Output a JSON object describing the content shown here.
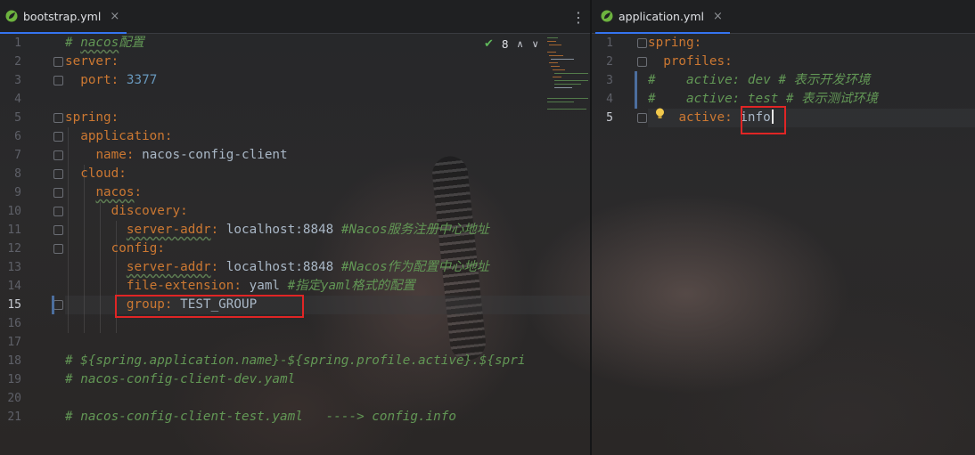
{
  "left_tab": {
    "title": "bootstrap.yml",
    "close": "×"
  },
  "right_tab": {
    "title": "application.yml",
    "close": "×"
  },
  "menu_icon": "⋮",
  "inspections": {
    "count": "8",
    "up": "∧",
    "down": "∨"
  },
  "left_lines": [
    {
      "n": "1"
    },
    {
      "n": "2"
    },
    {
      "n": "3"
    },
    {
      "n": "4"
    },
    {
      "n": "5"
    },
    {
      "n": "6"
    },
    {
      "n": "7"
    },
    {
      "n": "8"
    },
    {
      "n": "9"
    },
    {
      "n": "10"
    },
    {
      "n": "11"
    },
    {
      "n": "12"
    },
    {
      "n": "13"
    },
    {
      "n": "14"
    },
    {
      "n": "15"
    },
    {
      "n": "16"
    },
    {
      "n": "17"
    },
    {
      "n": "18"
    },
    {
      "n": "19"
    },
    {
      "n": "20"
    },
    {
      "n": "21"
    }
  ],
  "left_code": {
    "l1_hash": "# ",
    "l1_comment": "nacos",
    "l1_rest": "配置",
    "l2_key": "server",
    "l3_key": "port",
    "l3_val": "3377",
    "l5_key": "spring",
    "l6_key": "application",
    "l7_key": "name",
    "l7_val": "nacos-config-client",
    "l8_key": "cloud",
    "l9_key": "nacos",
    "l10_key": "discovery",
    "l11_key": "server-addr",
    "l11_val": "localhost:8848",
    "l11_comment": "#Nacos服务注册中心地址",
    "l12_key": "config",
    "l13_key": "server-addr",
    "l13_val": "localhost:8848",
    "l13_comment": "#Nacos作为配置中心地址",
    "l14_key": "file-extension",
    "l14_val": "yaml",
    "l14_comment": "#指定yaml格式的配置",
    "l15_key": "group",
    "l15_val": "TEST_GROUP",
    "l18_comment": "# ${spring.application.name}-${spring.profile.active}.${spri",
    "l19_comment": "# nacos-config-client-dev.yaml",
    "l21_comment": "# nacos-config-client-test.yaml   ----> config.info",
    "colon": ":"
  },
  "right_lines": [
    {
      "n": "1"
    },
    {
      "n": "2"
    },
    {
      "n": "3"
    },
    {
      "n": "4"
    },
    {
      "n": "5"
    }
  ],
  "right_code": {
    "r1_key": "spring",
    "r2_key": "profiles",
    "r3_hash": "#",
    "r3_comment": "    active: dev # 表示开发环境",
    "r4_hash": "#",
    "r4_comment": "    active: test # 表示测试环境",
    "r5_key": "active",
    "r5_val": "info",
    "colon": ":"
  },
  "colors": {
    "accent": "#3574f0",
    "highlight_box": "#e02525",
    "key": "#cc7832",
    "comment": "#629755",
    "number": "#6897bb"
  }
}
